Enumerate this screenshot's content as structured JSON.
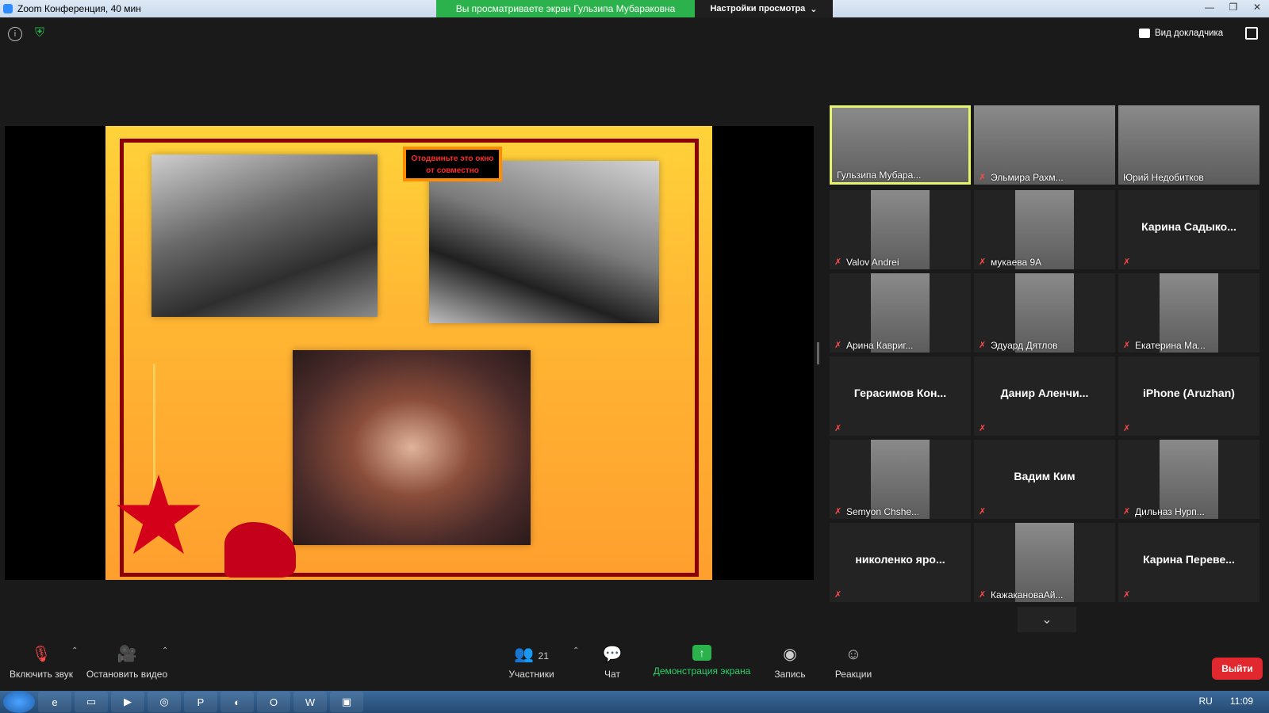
{
  "window": {
    "title": "Zoom Конференция, 40 мин",
    "share_banner": "Вы просматриваете экран Гульзипа Мубараковна",
    "view_options": "Настройки просмотра"
  },
  "header": {
    "speaker_view": "Вид докладчика"
  },
  "slide": {
    "popup_text": "Отодвиньте это окно от совместно"
  },
  "participants": [
    {
      "name": "Гульзипа Мубара...",
      "muted": false,
      "video": true,
      "active": true
    },
    {
      "name": "Эльмира Рахм...",
      "muted": true,
      "video": true
    },
    {
      "name": "Юрий Недобитков",
      "muted": false,
      "video": true
    },
    {
      "name": "Valov Andrei",
      "muted": true,
      "video": true
    },
    {
      "name": "мукаева 9А",
      "muted": true,
      "video": true
    },
    {
      "name": "Карина  Садыко...",
      "muted": true,
      "video": false
    },
    {
      "name": "Арина Кавриг...",
      "muted": true,
      "video": true
    },
    {
      "name": "Эдуард Дятлов",
      "muted": true,
      "video": true
    },
    {
      "name": "Екатерина Ма...",
      "muted": true,
      "video": true
    },
    {
      "name": "Герасимов  Кон...",
      "muted": true,
      "video": false
    },
    {
      "name": "Данир  Аленчи...",
      "muted": true,
      "video": false
    },
    {
      "name": "iPhone (Aruzhan)",
      "muted": true,
      "video": false
    },
    {
      "name": "Semyon Chshe...",
      "muted": true,
      "video": true
    },
    {
      "name": "Вадим Ким",
      "muted": true,
      "video": false
    },
    {
      "name": "Дильназ Нурп...",
      "muted": true,
      "video": true
    },
    {
      "name": "николенко  яро...",
      "muted": true,
      "video": false
    },
    {
      "name": "КажакановаАй...",
      "muted": true,
      "video": true
    },
    {
      "name": "Карина  Переве...",
      "muted": true,
      "video": false
    }
  ],
  "toolbar": {
    "unmute": "Включить звук",
    "stop_video": "Остановить видео",
    "participants_label": "Участники",
    "participants_count": "21",
    "chat": "Чат",
    "share_screen": "Демонстрация экрана",
    "record": "Запись",
    "reactions": "Реакции",
    "leave": "Выйти"
  },
  "taskbar": {
    "lang": "RU",
    "time": "11:09"
  }
}
